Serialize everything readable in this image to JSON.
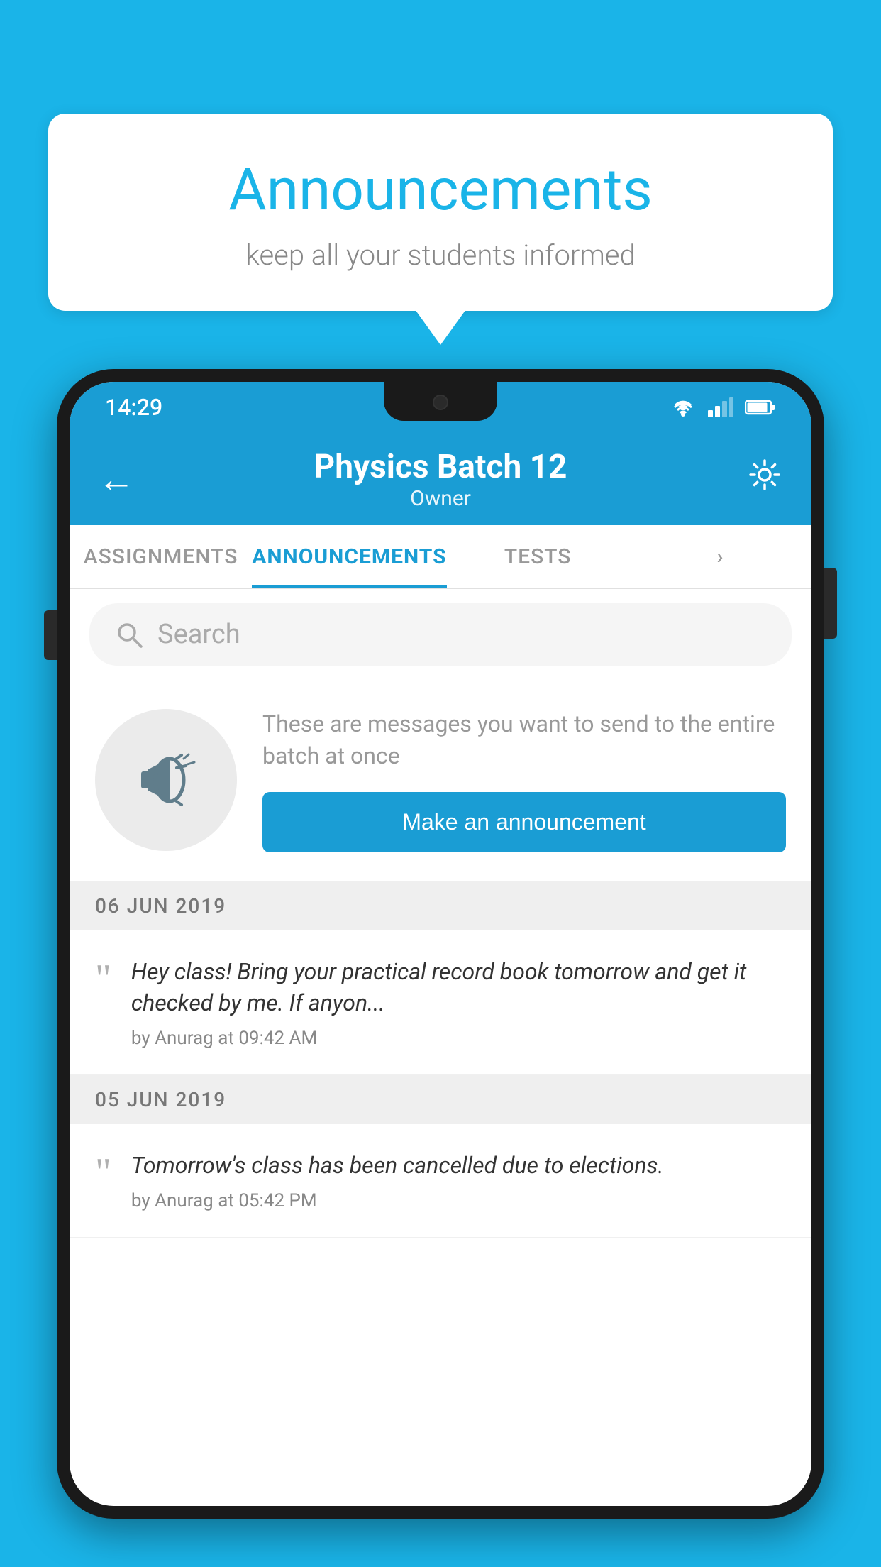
{
  "background_color": "#1ab4e8",
  "speech_bubble": {
    "title": "Announcements",
    "subtitle": "keep all your students informed"
  },
  "phone": {
    "status_bar": {
      "time": "14:29"
    },
    "header": {
      "title": "Physics Batch 12",
      "subtitle": "Owner",
      "back_label": "←",
      "settings_label": "⚙"
    },
    "tabs": [
      {
        "label": "ASSIGNMENTS",
        "active": false
      },
      {
        "label": "ANNOUNCEMENTS",
        "active": true
      },
      {
        "label": "TESTS",
        "active": false
      },
      {
        "label": "...",
        "active": false
      }
    ],
    "search": {
      "placeholder": "Search"
    },
    "promo": {
      "description": "These are messages you want to send to the entire batch at once",
      "button_label": "Make an announcement"
    },
    "announcements": [
      {
        "date": "06  JUN  2019",
        "text": "Hey class! Bring your practical record book tomorrow and get it checked by me. If anyon...",
        "meta": "by Anurag at 09:42 AM"
      },
      {
        "date": "05  JUN  2019",
        "text": "Tomorrow's class has been cancelled due to elections.",
        "meta": "by Anurag at 05:42 PM"
      }
    ]
  }
}
